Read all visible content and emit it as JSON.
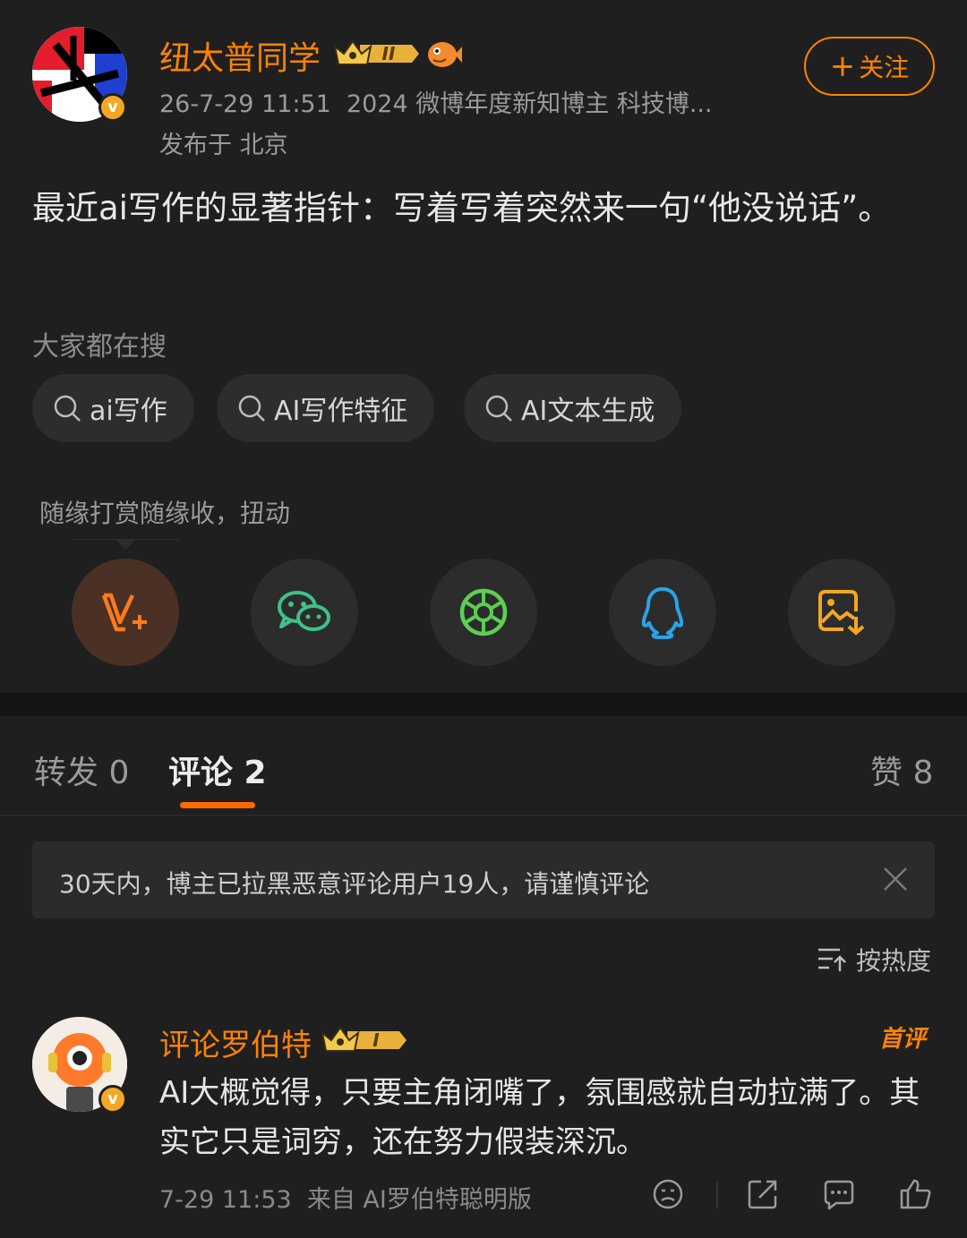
{
  "post": {
    "author": "纽太普同学",
    "crown_level": "II",
    "timestamp": "26-7-29 11:51",
    "badge_text": "2024 微博年度新知博主 科技博...",
    "location": "发布于 北京",
    "follow_label": "关注",
    "content": "最近ai写作的显著指针：写着写着突然来一句“他没说话”。"
  },
  "search": {
    "title": "大家都在搜",
    "chips": [
      "ai写作",
      "AI写作特征",
      "AI文本生成"
    ]
  },
  "reward": {
    "text": "随缘打赏随缘收，扭动"
  },
  "share": {
    "items": [
      {
        "icon": "weibo-v-plus-icon"
      },
      {
        "icon": "wechat-icon"
      },
      {
        "icon": "moments-icon"
      },
      {
        "icon": "qq-icon"
      },
      {
        "icon": "save-image-icon"
      }
    ]
  },
  "tabs": {
    "repost": "转发 0",
    "comment": "评论 2",
    "like": "赞 8"
  },
  "notice": {
    "text": "30天内，博主已拉黑恶意评论用户19人，请谨慎评论"
  },
  "sort": {
    "label": "按热度"
  },
  "comment": {
    "author": "评论罗伯特",
    "crown_level": "I",
    "first_badge": "首评",
    "text": "AI大概觉得，只要主角闭嘴了，氛围感就自动拉满了。其实它只是词穷，还在努力假装深沉。",
    "time": "7-29 11:53",
    "source": "来自 AI罗伯特聪明版"
  },
  "colors": {
    "accent": "#ff8200",
    "background": "#1f1f1f",
    "wechat": "#3ec28a",
    "qq": "#2aa3e8",
    "save": "#f5a623"
  }
}
